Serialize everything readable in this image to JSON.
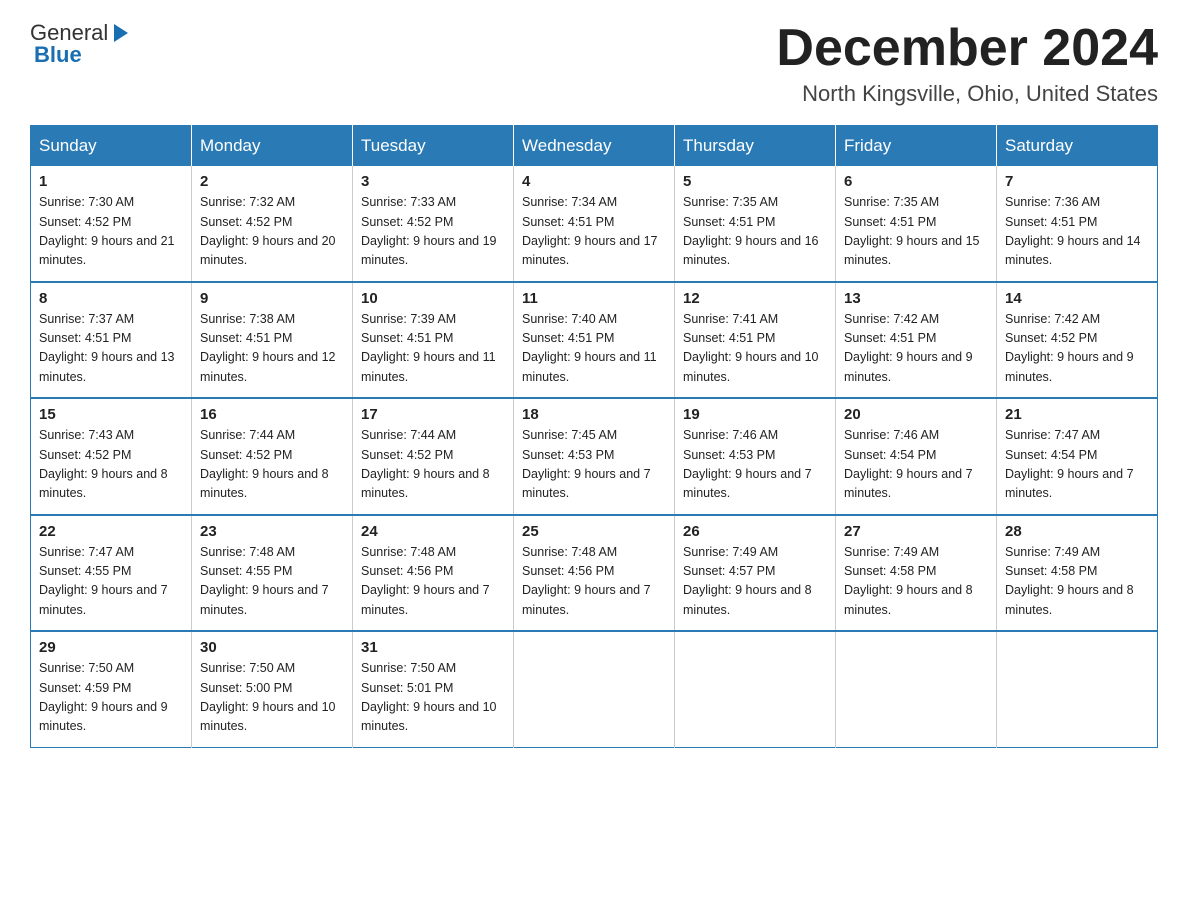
{
  "header": {
    "logo_general": "General",
    "logo_blue": "Blue",
    "month_title": "December 2024",
    "location": "North Kingsville, Ohio, United States"
  },
  "weekdays": [
    "Sunday",
    "Monday",
    "Tuesday",
    "Wednesday",
    "Thursday",
    "Friday",
    "Saturday"
  ],
  "weeks": [
    [
      {
        "day": "1",
        "sunrise": "7:30 AM",
        "sunset": "4:52 PM",
        "daylight": "9 hours and 21 minutes."
      },
      {
        "day": "2",
        "sunrise": "7:32 AM",
        "sunset": "4:52 PM",
        "daylight": "9 hours and 20 minutes."
      },
      {
        "day": "3",
        "sunrise": "7:33 AM",
        "sunset": "4:52 PM",
        "daylight": "9 hours and 19 minutes."
      },
      {
        "day": "4",
        "sunrise": "7:34 AM",
        "sunset": "4:51 PM",
        "daylight": "9 hours and 17 minutes."
      },
      {
        "day": "5",
        "sunrise": "7:35 AM",
        "sunset": "4:51 PM",
        "daylight": "9 hours and 16 minutes."
      },
      {
        "day": "6",
        "sunrise": "7:35 AM",
        "sunset": "4:51 PM",
        "daylight": "9 hours and 15 minutes."
      },
      {
        "day": "7",
        "sunrise": "7:36 AM",
        "sunset": "4:51 PM",
        "daylight": "9 hours and 14 minutes."
      }
    ],
    [
      {
        "day": "8",
        "sunrise": "7:37 AM",
        "sunset": "4:51 PM",
        "daylight": "9 hours and 13 minutes."
      },
      {
        "day": "9",
        "sunrise": "7:38 AM",
        "sunset": "4:51 PM",
        "daylight": "9 hours and 12 minutes."
      },
      {
        "day": "10",
        "sunrise": "7:39 AM",
        "sunset": "4:51 PM",
        "daylight": "9 hours and 11 minutes."
      },
      {
        "day": "11",
        "sunrise": "7:40 AM",
        "sunset": "4:51 PM",
        "daylight": "9 hours and 11 minutes."
      },
      {
        "day": "12",
        "sunrise": "7:41 AM",
        "sunset": "4:51 PM",
        "daylight": "9 hours and 10 minutes."
      },
      {
        "day": "13",
        "sunrise": "7:42 AM",
        "sunset": "4:51 PM",
        "daylight": "9 hours and 9 minutes."
      },
      {
        "day": "14",
        "sunrise": "7:42 AM",
        "sunset": "4:52 PM",
        "daylight": "9 hours and 9 minutes."
      }
    ],
    [
      {
        "day": "15",
        "sunrise": "7:43 AM",
        "sunset": "4:52 PM",
        "daylight": "9 hours and 8 minutes."
      },
      {
        "day": "16",
        "sunrise": "7:44 AM",
        "sunset": "4:52 PM",
        "daylight": "9 hours and 8 minutes."
      },
      {
        "day": "17",
        "sunrise": "7:44 AM",
        "sunset": "4:52 PM",
        "daylight": "9 hours and 8 minutes."
      },
      {
        "day": "18",
        "sunrise": "7:45 AM",
        "sunset": "4:53 PM",
        "daylight": "9 hours and 7 minutes."
      },
      {
        "day": "19",
        "sunrise": "7:46 AM",
        "sunset": "4:53 PM",
        "daylight": "9 hours and 7 minutes."
      },
      {
        "day": "20",
        "sunrise": "7:46 AM",
        "sunset": "4:54 PM",
        "daylight": "9 hours and 7 minutes."
      },
      {
        "day": "21",
        "sunrise": "7:47 AM",
        "sunset": "4:54 PM",
        "daylight": "9 hours and 7 minutes."
      }
    ],
    [
      {
        "day": "22",
        "sunrise": "7:47 AM",
        "sunset": "4:55 PM",
        "daylight": "9 hours and 7 minutes."
      },
      {
        "day": "23",
        "sunrise": "7:48 AM",
        "sunset": "4:55 PM",
        "daylight": "9 hours and 7 minutes."
      },
      {
        "day": "24",
        "sunrise": "7:48 AM",
        "sunset": "4:56 PM",
        "daylight": "9 hours and 7 minutes."
      },
      {
        "day": "25",
        "sunrise": "7:48 AM",
        "sunset": "4:56 PM",
        "daylight": "9 hours and 7 minutes."
      },
      {
        "day": "26",
        "sunrise": "7:49 AM",
        "sunset": "4:57 PM",
        "daylight": "9 hours and 8 minutes."
      },
      {
        "day": "27",
        "sunrise": "7:49 AM",
        "sunset": "4:58 PM",
        "daylight": "9 hours and 8 minutes."
      },
      {
        "day": "28",
        "sunrise": "7:49 AM",
        "sunset": "4:58 PM",
        "daylight": "9 hours and 8 minutes."
      }
    ],
    [
      {
        "day": "29",
        "sunrise": "7:50 AM",
        "sunset": "4:59 PM",
        "daylight": "9 hours and 9 minutes."
      },
      {
        "day": "30",
        "sunrise": "7:50 AM",
        "sunset": "5:00 PM",
        "daylight": "9 hours and 10 minutes."
      },
      {
        "day": "31",
        "sunrise": "7:50 AM",
        "sunset": "5:01 PM",
        "daylight": "9 hours and 10 minutes."
      },
      null,
      null,
      null,
      null
    ]
  ]
}
